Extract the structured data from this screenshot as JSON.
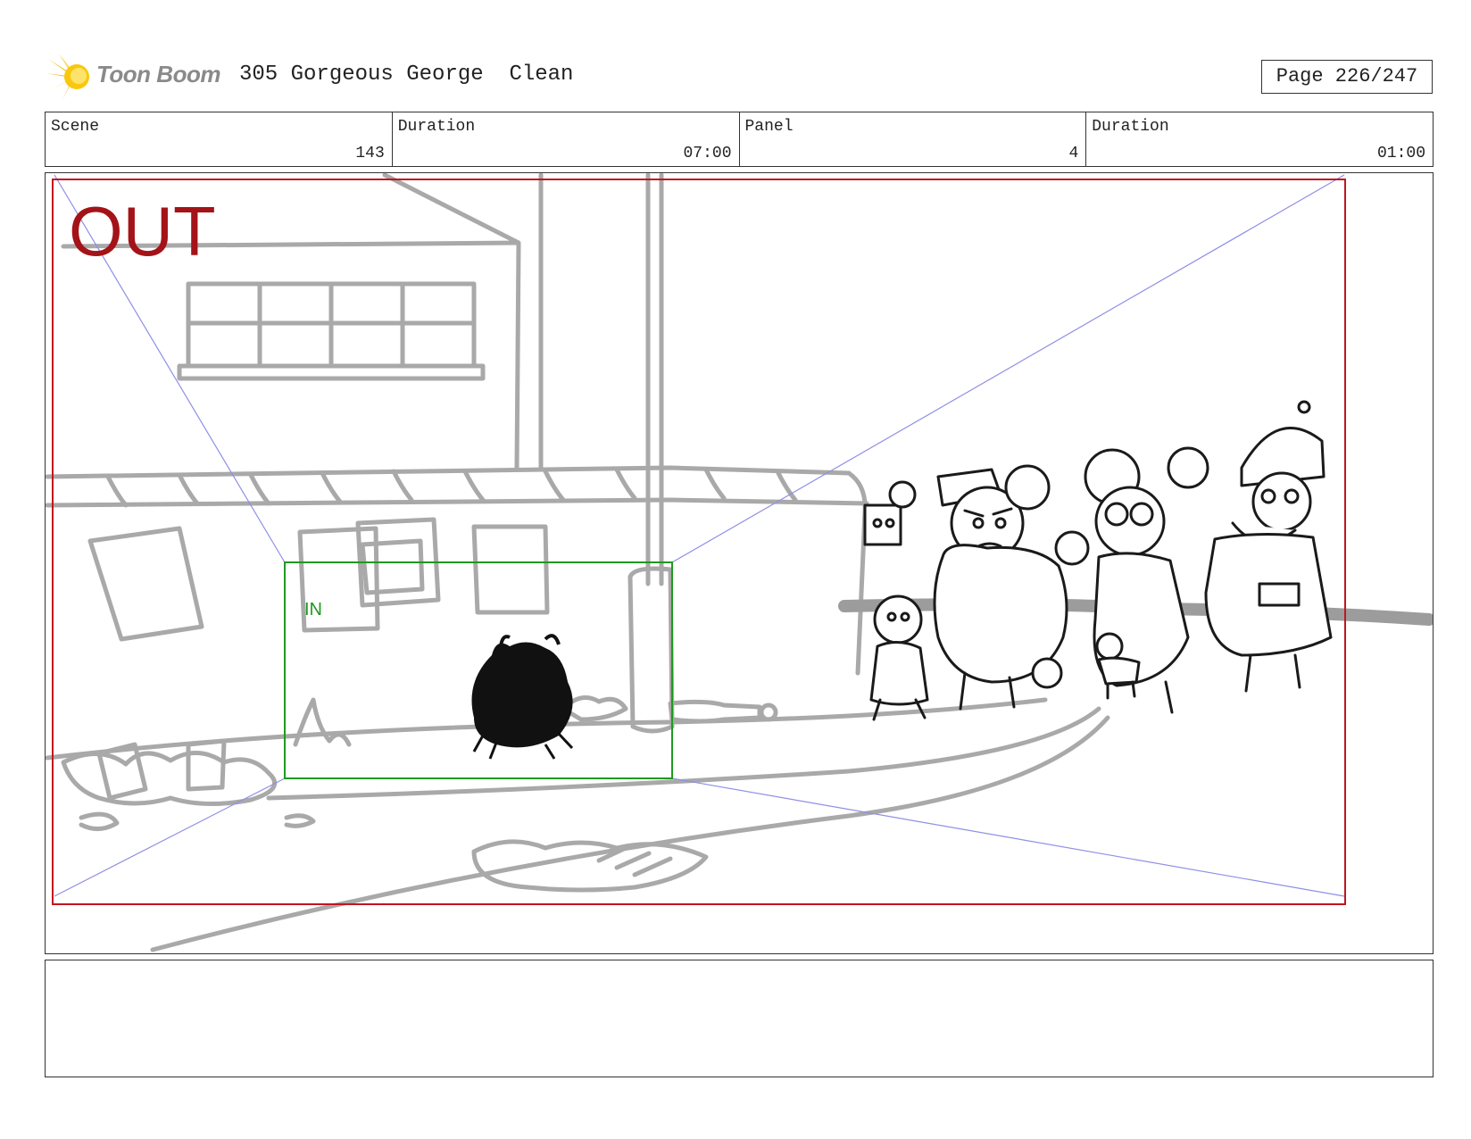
{
  "header": {
    "logo_text": "Toon Boom",
    "title": "305 Gorgeous George  Clean",
    "page_label": "Page 226/247"
  },
  "info": {
    "scene_label": "Scene",
    "scene_value": "143",
    "scene_duration_label": "Duration",
    "scene_duration_value": "07:00",
    "panel_label": "Panel",
    "panel_value": "4",
    "panel_duration_label": "Duration",
    "panel_duration_value": "01:00"
  },
  "panel": {
    "out_label": "OUT",
    "in_label": "IN"
  },
  "notes": {
    "text": ""
  },
  "colors": {
    "out_frame": "#c0161f",
    "in_frame": "#1e9a1e",
    "guide_lines": "#8f8fe6",
    "background_sketch": "#a9a9a9",
    "character_ink": "#1a1a1a"
  }
}
